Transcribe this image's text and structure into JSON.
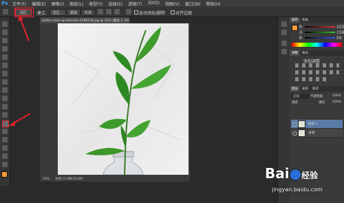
{
  "app": {
    "logo": "Ps"
  },
  "menu": [
    "文件(F)",
    "编辑(E)",
    "图像(I)",
    "图层(L)",
    "类型(Y)",
    "选择(S)",
    "滤镜(T)",
    "3D(D)",
    "视图(V)",
    "窗口(W)",
    "帮助(H)"
  ],
  "options": {
    "highlight_label": "选区",
    "mode_label": "建立:",
    "btn1": "选区...",
    "btn2": "蒙版",
    "btn3": "形状",
    "align_label": "自动添加/删除",
    "align_check": "对齐边缘"
  },
  "document": {
    "tab_title": "bottle-close-up-delicate-2280528.jpg @ 25% (图层 1, RGB/8) *",
    "zoom": "25%",
    "status": "文档:15.8M/31.6M"
  },
  "panels": {
    "color_tabs": [
      "颜色",
      "色板"
    ],
    "sliders": [
      {
        "label": "R",
        "value": "255",
        "color": "#e33"
      },
      {
        "label": "G",
        "value": "156",
        "color": "#3c3"
      },
      {
        "label": "B",
        "value": "56",
        "color": "#35f"
      }
    ],
    "adjust_tabs": [
      "调整",
      "样式"
    ],
    "adjust_title": "添加调整",
    "layers_tabs": [
      "图层",
      "通道",
      "路径"
    ],
    "blend_mode": "正常",
    "opacity_label": "不透明度:",
    "opacity_value": "100%",
    "fill_label": "填充:",
    "fill_value": "100%",
    "lock_label": "锁定:",
    "layers": [
      {
        "name": "图层 1",
        "selected": true
      },
      {
        "name": "背景",
        "selected": false
      }
    ]
  },
  "watermark": {
    "brand": "Bai",
    "brand2": "经验",
    "url": "jingyan.baidu.com"
  },
  "colors": {
    "accent_red": "#e2232d",
    "fg_swatch": "#ff9c38",
    "selection": "#5a7ba6"
  }
}
